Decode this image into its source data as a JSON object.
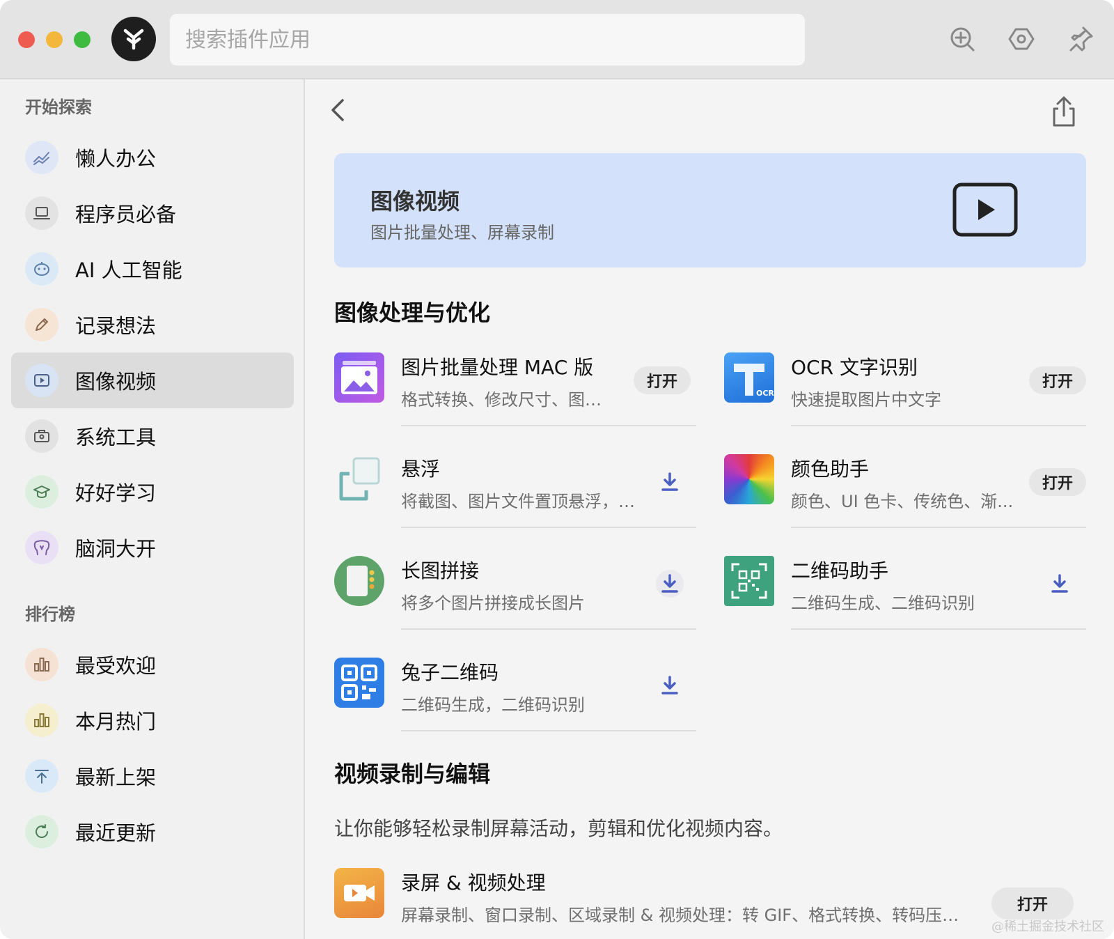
{
  "search": {
    "placeholder": "搜索插件应用"
  },
  "sidebar": {
    "explore_heading": "开始探索",
    "explore_items": [
      {
        "label": "懒人办公",
        "icon": "chart-trend-icon",
        "color": "#dfe7f6"
      },
      {
        "label": "程序员必备",
        "icon": "laptop-icon",
        "color": "#e3e3e3"
      },
      {
        "label": "AI 人工智能",
        "icon": "robot-face-icon",
        "color": "#dbe9f7"
      },
      {
        "label": "记录想法",
        "icon": "pencil-icon",
        "color": "#f6e4d4"
      },
      {
        "label": "图像视频",
        "icon": "play-icon",
        "color": "#d8e3f3",
        "active": true
      },
      {
        "label": "系统工具",
        "icon": "toolbox-icon",
        "color": "#e2e2e2"
      },
      {
        "label": "好好学习",
        "icon": "graduation-cap-icon",
        "color": "#dcefdf"
      },
      {
        "label": "脑洞大开",
        "icon": "brain-icon",
        "color": "#e9e0f5"
      }
    ],
    "ranking_heading": "排行榜",
    "ranking_items": [
      {
        "label": "最受欢迎",
        "icon": "bar-chart-icon",
        "color": "#f6e2d4"
      },
      {
        "label": "本月热门",
        "icon": "bar-chart-icon",
        "color": "#f5efcf"
      },
      {
        "label": "最新上架",
        "icon": "upload-arrow-icon",
        "color": "#d9e9f7"
      },
      {
        "label": "最近更新",
        "icon": "refresh-icon",
        "color": "#dcefdf"
      }
    ]
  },
  "banner": {
    "title": "图像视频",
    "subtitle": "图片批量处理、屏幕录制"
  },
  "section1": {
    "title": "图像处理与优化",
    "plugins": [
      {
        "name": "图片批量处理 MAC 版",
        "desc": "格式转换、修改尺寸、图片...",
        "action": "打开",
        "icon": "image-batch-icon"
      },
      {
        "name": "OCR 文字识别",
        "desc": "快速提取图片中文字",
        "action": "打开",
        "icon": "ocr-icon",
        "icon_text": "OCR"
      },
      {
        "name": "悬浮",
        "desc": "将截图、图片文件置顶悬浮，同...",
        "action": "download",
        "icon": "float-window-icon"
      },
      {
        "name": "颜色助手",
        "desc": "颜色、UI 色卡、传统色、渐...",
        "action": "打开",
        "icon": "color-wheel-icon"
      },
      {
        "name": "长图拼接",
        "desc": "将多个图片拼接成长图片",
        "action": "download",
        "icon": "long-image-icon"
      },
      {
        "name": "二维码助手",
        "desc": "二维码生成、二维码识别",
        "action": "download",
        "icon": "qr-scan-icon"
      },
      {
        "name": "兔子二维码",
        "desc": "二维码生成，二维码识别",
        "action": "download",
        "icon": "qr-code-icon"
      }
    ]
  },
  "section2": {
    "title": "视频录制与编辑",
    "desc": "让你能够轻松录制屏幕活动，剪辑和优化视频内容。",
    "plugins": [
      {
        "name": "录屏 & 视频处理",
        "desc": "屏幕录制、窗口录制、区域录制 & 视频处理：转 GIF、格式转换、转码压缩...",
        "action": "打开",
        "icon": "video-camera-icon"
      }
    ]
  },
  "open_label": "打开",
  "watermark": "@稀土掘金技术社区",
  "colors": {
    "accent": "#4a5fc1",
    "banner": "#d4e1fa",
    "active_item": "#dcdcdc"
  }
}
